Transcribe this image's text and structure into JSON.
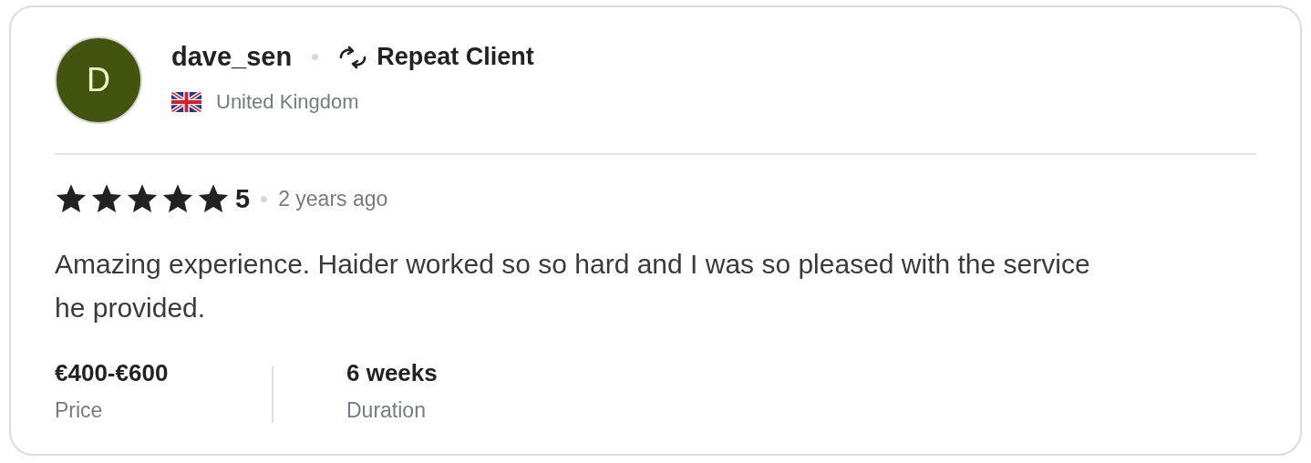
{
  "reviewer": {
    "initial": "D",
    "name": "dave_sen",
    "badge": "Repeat Client",
    "country": "United Kingdom"
  },
  "rating": {
    "stars": 5,
    "score": "5",
    "time": "2 years ago"
  },
  "review_text": "Amazing experience. Haider worked so so hard and I was so pleased with the service he provided.",
  "stats": [
    {
      "value": "€400-€600",
      "label": "Price"
    },
    {
      "value": "6 weeks",
      "label": "Duration"
    }
  ]
}
